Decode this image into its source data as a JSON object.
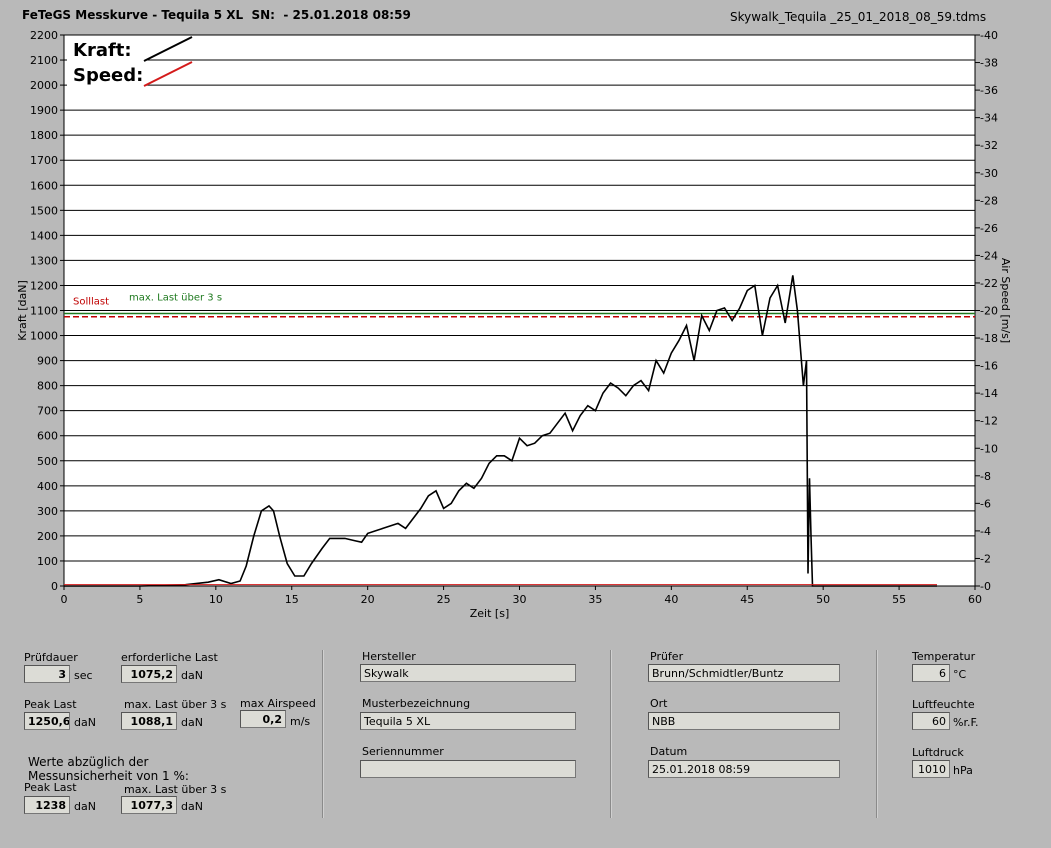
{
  "header": {
    "title": "FeTeGS Messkurve - Tequila 5 XL  SN:  - 25.01.2018 08:59",
    "filename": "Skywalk_Tequila _25_01_2018_08_59.tdms"
  },
  "chart_data": {
    "type": "line",
    "xlabel": "Zeit [s]",
    "ylabel": "Kraft [daN]",
    "y2label": "Air Speed [m/s]",
    "xlim": [
      0,
      60
    ],
    "ylim": [
      0,
      2200
    ],
    "y2lim": [
      0,
      40
    ],
    "xticks": [
      "0",
      "5",
      "10",
      "15",
      "20",
      "25",
      "30",
      "35",
      "40",
      "45",
      "50",
      "55",
      "60"
    ],
    "yticks": [
      "0",
      "100",
      "200",
      "300",
      "400",
      "500",
      "600",
      "700",
      "800",
      "900",
      "1000",
      "1100",
      "1200",
      "1300",
      "1400",
      "1500",
      "1600",
      "1700",
      "1800",
      "1900",
      "2000",
      "2100",
      "2200"
    ],
    "y2ticks": [
      "0",
      "2",
      "4",
      "6",
      "8",
      "10",
      "12",
      "14",
      "16",
      "18",
      "20",
      "22",
      "24",
      "26",
      "28",
      "30",
      "32",
      "34",
      "36",
      "38",
      "40"
    ],
    "grid": true,
    "legend": [
      "Kraft:",
      "Speed:"
    ],
    "colors": {
      "kraft": "#000000",
      "speed": "#d41a1a",
      "solllast": "#c00000",
      "maxlast": "#1f7a1f"
    },
    "annotations": {
      "solllast_label": "Solllast",
      "solllast_value": 1075,
      "maxlast_label": "max. Last über  3 s",
      "maxlast_value": 1088
    },
    "series": [
      {
        "name": "Kraft",
        "x": [
          0,
          2,
          5,
          8,
          9.5,
          10.2,
          11,
          11.6,
          12,
          12.5,
          13,
          13.5,
          13.8,
          14.2,
          14.7,
          15.2,
          15.8,
          16.3,
          17,
          17.5,
          18,
          18.5,
          19.2,
          19.6,
          20,
          20.5,
          21,
          21.5,
          22,
          22.5,
          23,
          23.5,
          24,
          24.5,
          25,
          25.5,
          26,
          26.5,
          27,
          27.5,
          28,
          28.5,
          29,
          29.5,
          30,
          30.5,
          31,
          31.5,
          32,
          32.5,
          33,
          33.5,
          34,
          34.5,
          35,
          35.5,
          36,
          36.5,
          37,
          37.5,
          38,
          38.5,
          39,
          39.5,
          40,
          40.5,
          41,
          41.5,
          42,
          42.5,
          43,
          43.5,
          44,
          44.5,
          45,
          45.5,
          46,
          46.5,
          47,
          47.5,
          48,
          48.3,
          48.5,
          48.7,
          48.9,
          49,
          49.1,
          49.2,
          49.3,
          49.5,
          50,
          52,
          55,
          57.5
        ],
        "values": [
          0,
          0,
          0,
          5,
          15,
          25,
          10,
          20,
          80,
          200,
          300,
          320,
          300,
          200,
          90,
          40,
          40,
          90,
          150,
          190,
          190,
          190,
          180,
          175,
          210,
          220,
          230,
          240,
          250,
          230,
          270,
          310,
          360,
          380,
          310,
          330,
          380,
          410,
          390,
          430,
          490,
          520,
          520,
          500,
          590,
          560,
          570,
          600,
          610,
          650,
          690,
          620,
          680,
          720,
          700,
          770,
          810,
          790,
          760,
          800,
          820,
          780,
          900,
          850,
          930,
          980,
          1040,
          900,
          1080,
          1020,
          1100,
          1110,
          1060,
          1110,
          1180,
          1200,
          1000,
          1150,
          1200,
          1050,
          1240,
          1100,
          950,
          800,
          900,
          50,
          430,
          200,
          0,
          0,
          0,
          0,
          0,
          0
        ]
      },
      {
        "name": "Speed",
        "x": [
          0,
          57.5
        ],
        "values": [
          0.1,
          0.1
        ]
      }
    ]
  },
  "panel": {
    "pruefdauer_label": "Prüfdauer",
    "pruefdauer_value": "3",
    "pruefdauer_unit": "sec",
    "erf_last_label": "erforderliche Last",
    "erf_last_value": "1075,2",
    "erf_last_unit": "daN",
    "peak_label": "Peak Last",
    "peak_value": "1250,6",
    "peak_unit": "daN",
    "max3_label": "max. Last über  3 s",
    "max3_value": "1088,1",
    "max3_unit": "daN",
    "airspeed_label": "max Airspeed",
    "airspeed_value": "0,2",
    "airspeed_unit": "m/s",
    "werte_line1": "Werte abzüglich der",
    "werte_line2": "Messunsicherheit von 1  %:",
    "peak2_label": "Peak Last",
    "peak2_value": "1238",
    "peak2_unit": "daN",
    "max3b_label": "max. Last über  3 s",
    "max3b_value": "1077,3",
    "max3b_unit": "daN",
    "hersteller_label": "Hersteller",
    "hersteller_value": "Skywalk",
    "muster_label": "Musterbezeichnung",
    "muster_value": "Tequila 5 XL",
    "serien_label": "Seriennummer",
    "serien_value": "",
    "pruefer_label": "Prüfer",
    "pruefer_value": "Brunn/Schmidtler/Buntz",
    "ort_label": "Ort",
    "ort_value": "NBB",
    "datum_label": "Datum",
    "datum_value": "25.01.2018 08:59",
    "temp_label": "Temperatur",
    "temp_value": "6",
    "temp_unit": "°C",
    "feuchte_label": "Luftfeuchte",
    "feuchte_value": "60",
    "feuchte_unit": "%r.F.",
    "druck_label": "Luftdruck",
    "druck_value": "1010",
    "druck_unit": "hPa"
  }
}
